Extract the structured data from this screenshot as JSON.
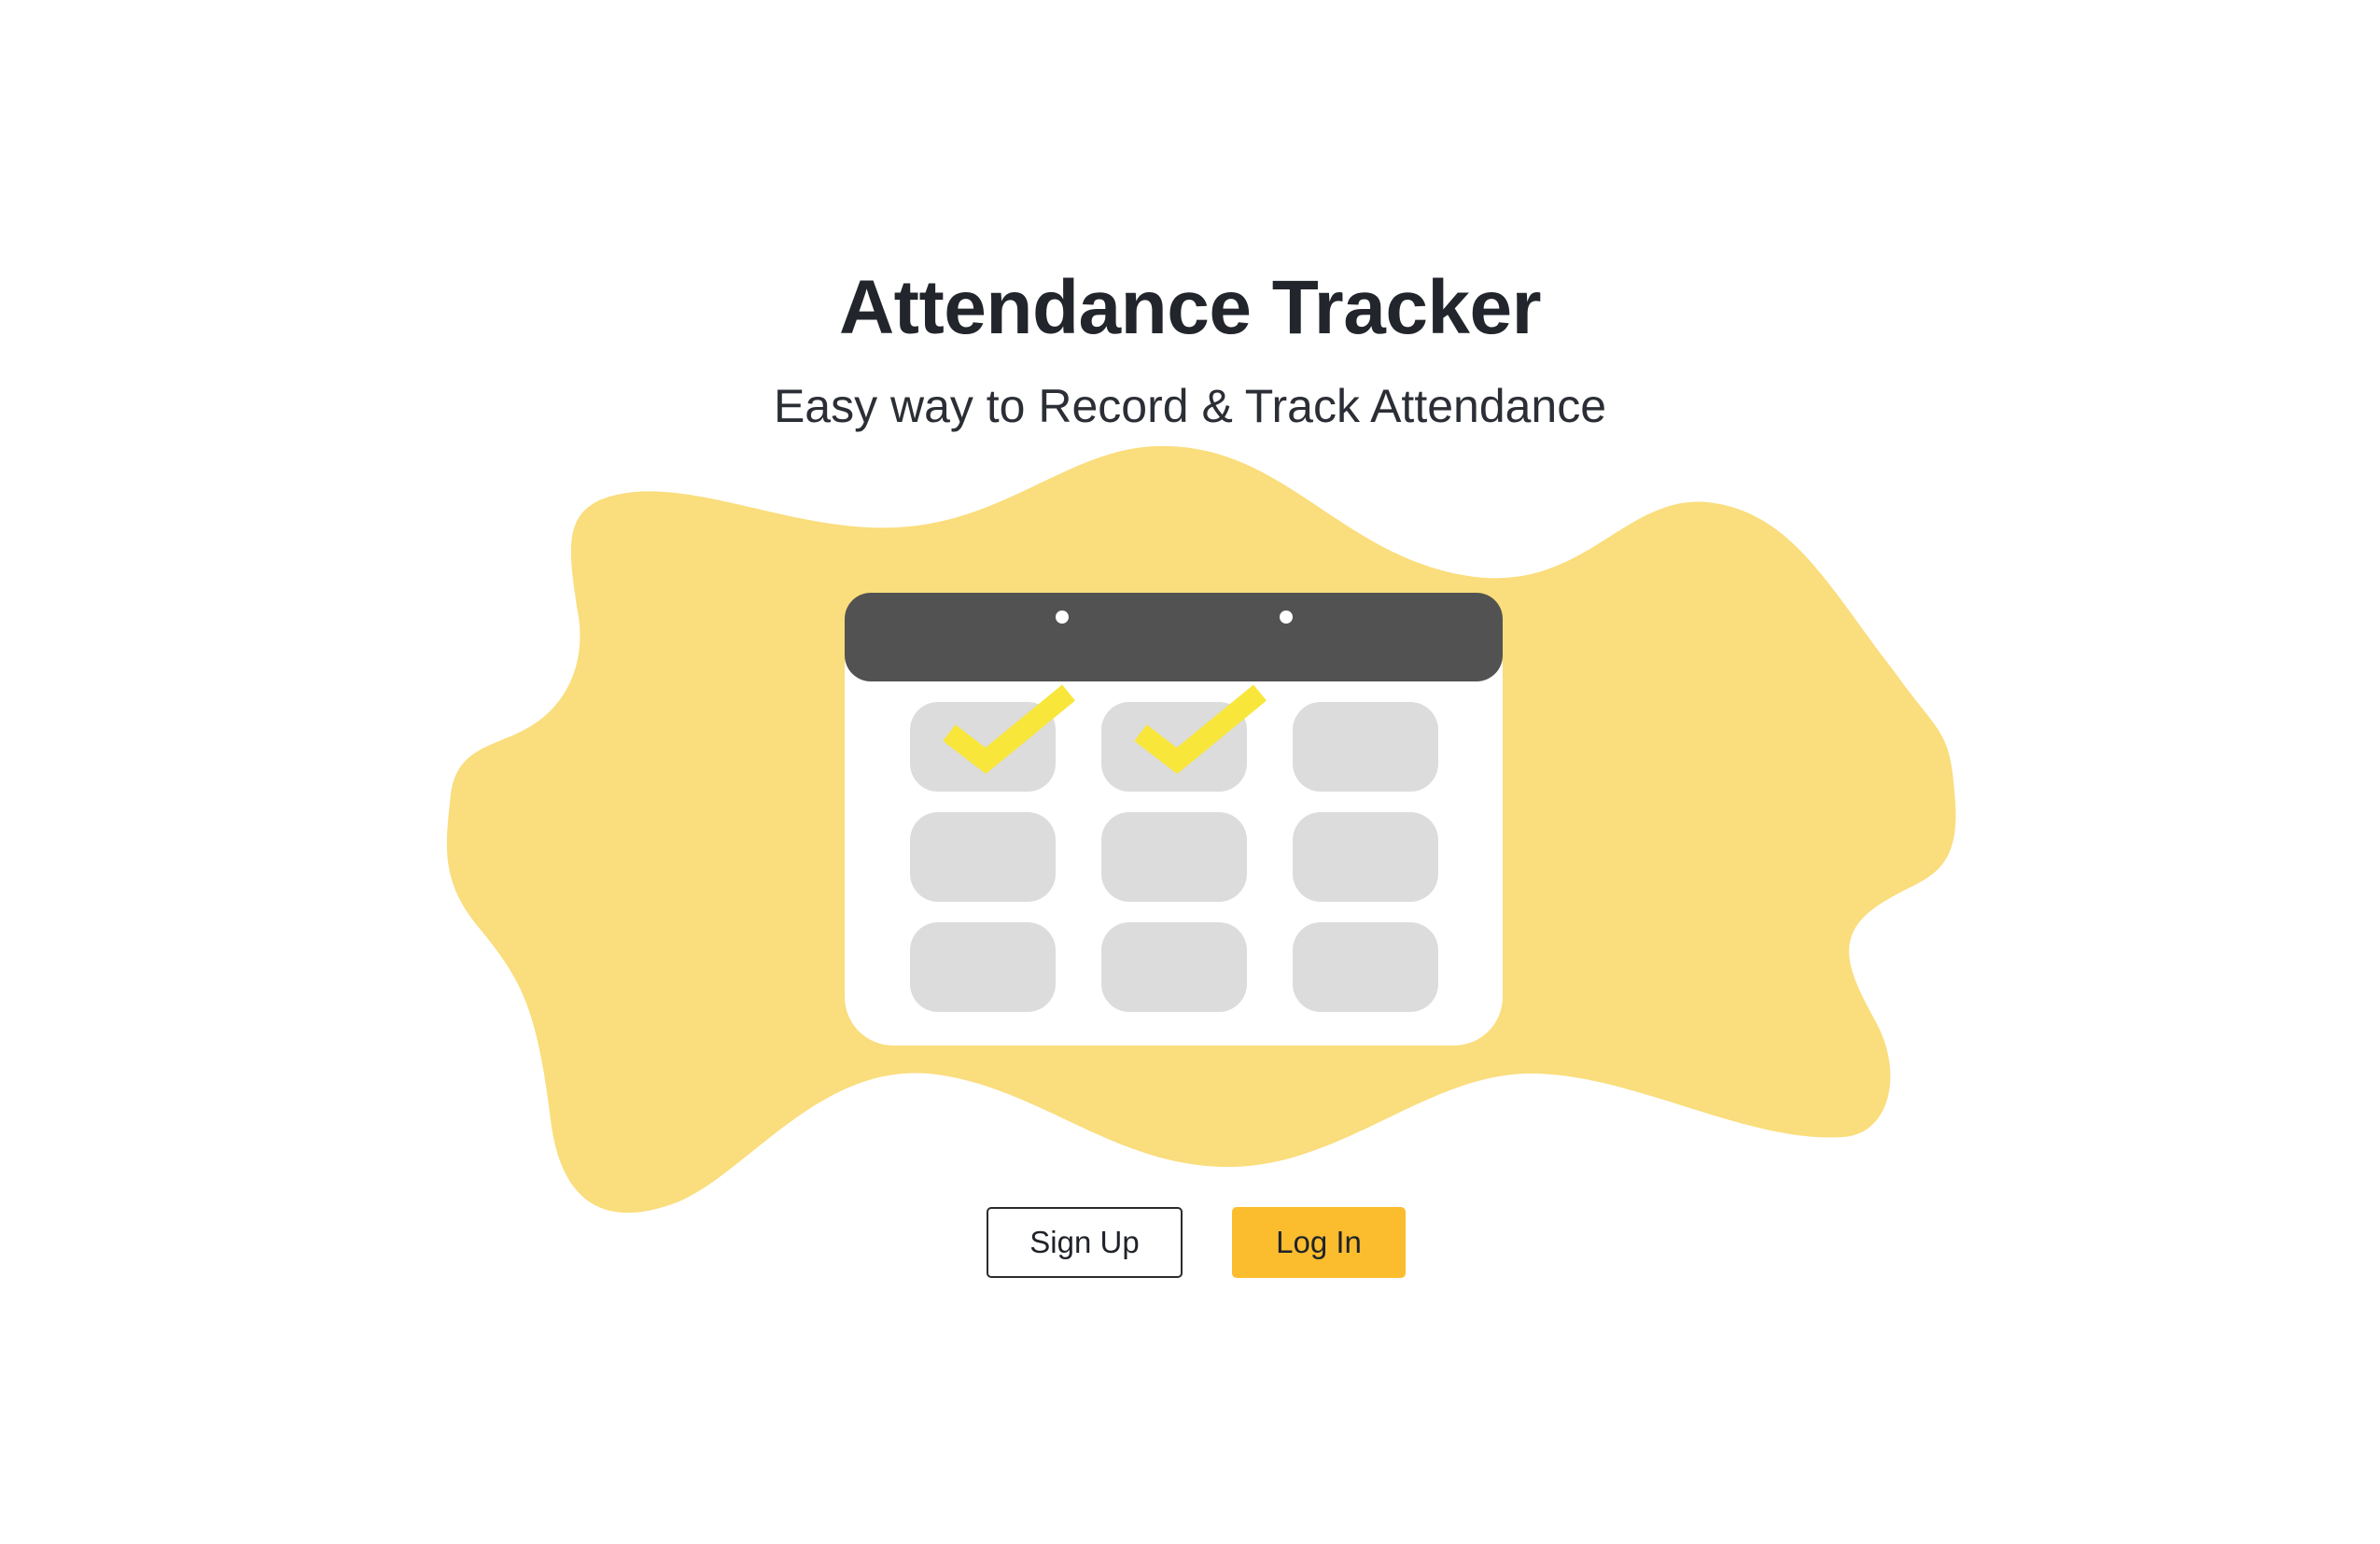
{
  "header": {
    "title": "Attendance Tracker",
    "subtitle": "Easy way to Record & Track Attendance"
  },
  "illustration": {
    "icon": "calendar-icon",
    "checked_days": 2,
    "total_days": 9,
    "colors": {
      "blob": "#fadd7c",
      "calendar_header": "#525252",
      "calendar_body": "#ffffff",
      "day_cell": "#dcdcdc",
      "checkmark": "#f8e63a"
    }
  },
  "actions": {
    "signup_label": "Sign Up",
    "login_label": "Log In"
  },
  "colors": {
    "accent": "#fbbd2e",
    "text": "#22252b"
  }
}
